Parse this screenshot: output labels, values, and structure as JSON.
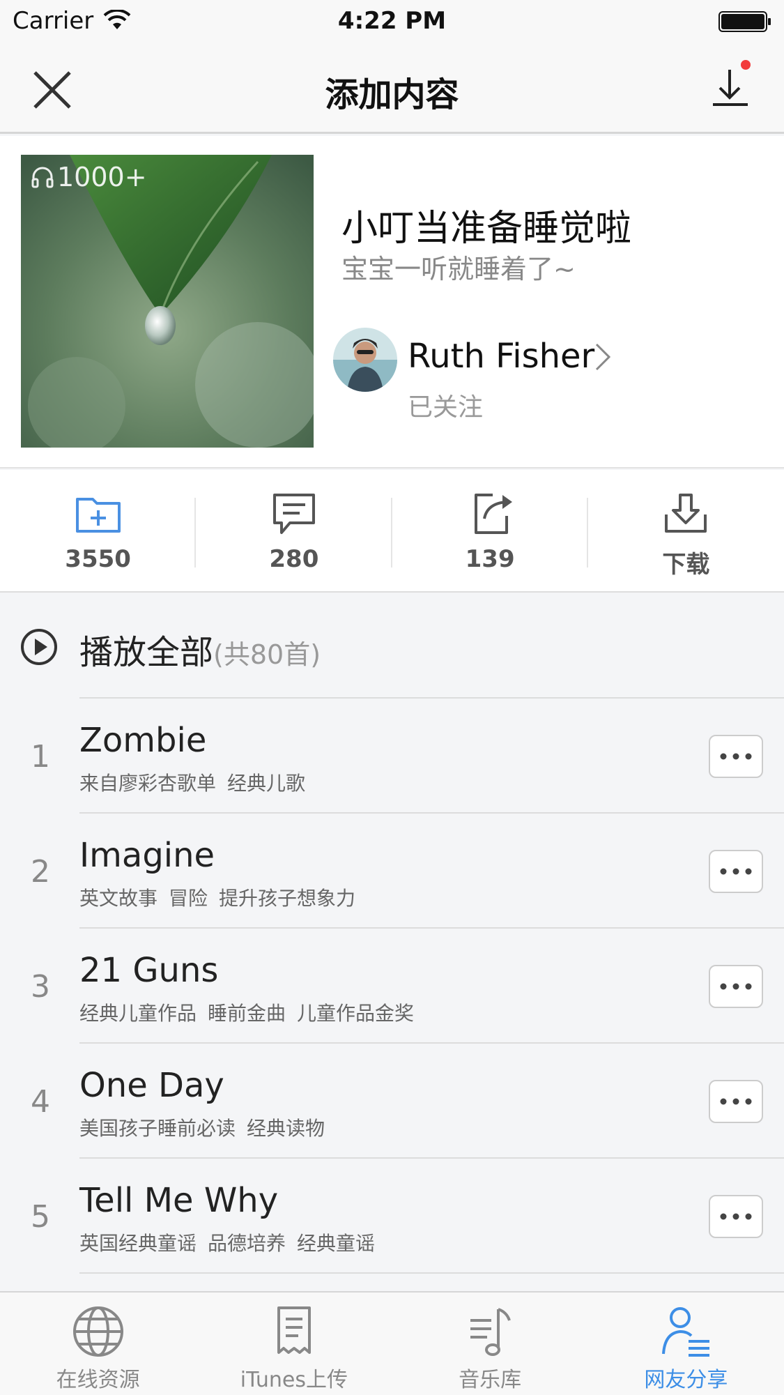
{
  "status_bar": {
    "carrier": "Carrier",
    "time": "4:22 PM"
  },
  "nav": {
    "title": "添加内容"
  },
  "album": {
    "play_count": "1000+",
    "title": "小叮当准备睡觉啦",
    "subtitle": "宝宝一听就睡着了~",
    "author": "Ruth Fisher",
    "follow_status": "已关注"
  },
  "stats": [
    {
      "icon": "add-folder-icon",
      "value": "3550"
    },
    {
      "icon": "comment-icon",
      "value": "280"
    },
    {
      "icon": "share-icon",
      "value": "139"
    },
    {
      "icon": "download-icon",
      "value": "下载"
    }
  ],
  "play_all": {
    "label": "播放全部",
    "count": "(共80首)"
  },
  "tracks": [
    {
      "index": "1",
      "title": "Zombie",
      "tags": [
        "来自廖彩杏歌单",
        "经典儿歌"
      ]
    },
    {
      "index": "2",
      "title": "Imagine",
      "tags": [
        "英文故事",
        "冒险",
        "提升孩子想象力"
      ]
    },
    {
      "index": "3",
      "title": "21 Guns",
      "tags": [
        "经典儿童作品",
        "睡前金曲",
        "儿童作品金奖"
      ]
    },
    {
      "index": "4",
      "title": "One Day",
      "tags": [
        "美国孩子睡前必读",
        "经典读物"
      ]
    },
    {
      "index": "5",
      "title": "Tell Me Why",
      "tags": [
        "英国经典童谣",
        "品德培养",
        "经典童谣"
      ]
    }
  ],
  "tab_bar": {
    "items": [
      {
        "label": "在线资源",
        "icon": "globe-icon",
        "active": false
      },
      {
        "label": "iTunes上传",
        "icon": "receipt-icon",
        "active": false
      },
      {
        "label": "音乐库",
        "icon": "music-library-icon",
        "active": false
      },
      {
        "label": "网友分享",
        "icon": "user-share-icon",
        "active": true
      }
    ]
  },
  "colors": {
    "accent": "#3d8ee6",
    "icon_blue": "#4a90e2",
    "badge_red": "#f23b3b"
  }
}
